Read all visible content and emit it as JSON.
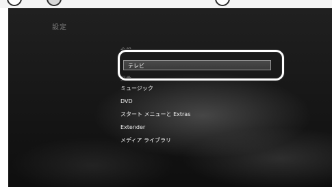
{
  "screen": {
    "title": "設定"
  },
  "menu": {
    "items": [
      {
        "label": "全般",
        "state": "faded"
      },
      {
        "label": "テレビ",
        "state": "selected"
      },
      {
        "label": "画像",
        "state": "faded"
      },
      {
        "label": "ミュージック",
        "state": "normal"
      },
      {
        "label": "DVD",
        "state": "normal"
      },
      {
        "label": "スタート メニューと Extras",
        "state": "normal"
      },
      {
        "label": "Extender",
        "state": "normal"
      },
      {
        "label": "メディア ライブラリ",
        "state": "normal"
      }
    ]
  },
  "colors": {
    "screen_background": "#141414",
    "selection_border": "#9a9a9a",
    "callout_ring": "#ffffff"
  }
}
